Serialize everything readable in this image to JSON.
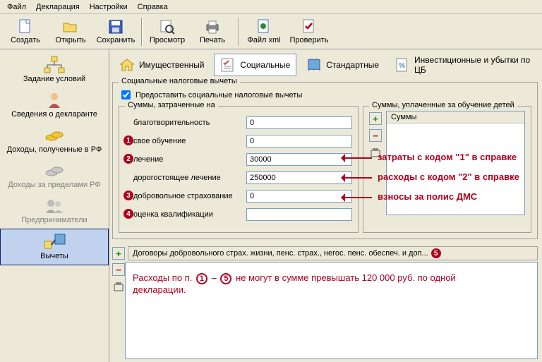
{
  "menu": {
    "file": "Файл",
    "decl": "Декларация",
    "settings": "Настройки",
    "help": "Справка"
  },
  "toolbar": {
    "create": "Создать",
    "open": "Открыть",
    "save": "Сохранить",
    "preview": "Просмотр",
    "print": "Печать",
    "filexml": "Файл xml",
    "check": "Проверить"
  },
  "sidebar": {
    "cond": "Задание условий",
    "declarant": "Сведения о декларанте",
    "income_rf": "Доходы, полученные в РФ",
    "income_abroad": "Доходы за пределами РФ",
    "entrepreneur": "Предприниматели",
    "deductions": "Вычеты"
  },
  "tabs": {
    "property": "Имущественный",
    "social": "Социальные",
    "standard": "Стандартные",
    "invest": "Инвестиционные и убытки по ЦБ"
  },
  "group": {
    "title": "Социальные налоговые вычеты",
    "checkbox": "Предоставить социальные налоговые вычеты",
    "spent_title": "Суммы, затраченные на",
    "edu_title": "Суммы, уплаченные за обучение детей",
    "list_col": "Суммы"
  },
  "fields": {
    "charity": "благотворительность",
    "own_edu": "свое обучение",
    "treatment": "лечение",
    "exp_treatment": "дорогостоящее лечение",
    "insurance": "добровольное страхование",
    "qualification": "оценка квалификации"
  },
  "values": {
    "charity": "0",
    "own_edu": "0",
    "treatment": "30000",
    "exp_treatment": "250000",
    "insurance": "0",
    "qualification": ""
  },
  "anno": {
    "a1": "затраты с кодом \"1\" в справке",
    "a2": "расходы с кодом \"2\" в справке",
    "a3": "взносы за полис ДМС"
  },
  "bottom": {
    "title": "Договоры добровольного страх. жизни, пенс. страх., негос. пенс. обеспеч. и доп...",
    "note_pre": "Расходы по п.",
    "note_mid": "не могут в сумме превышать 120 000 руб. по одной",
    "note_end": "декларации."
  }
}
